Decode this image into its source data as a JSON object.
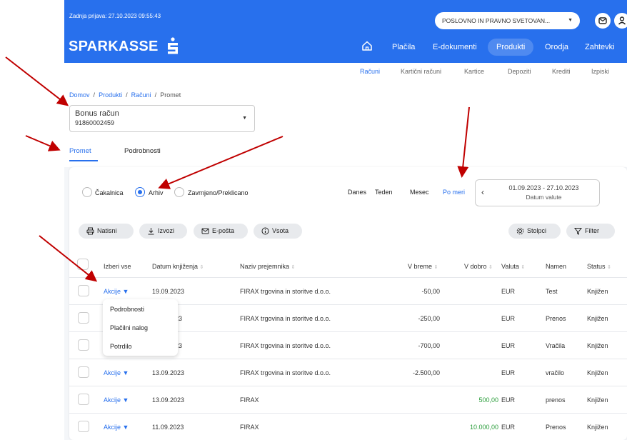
{
  "header": {
    "last_login": "Zadnja prijava: 27.10.2023 09:55:43",
    "account_selector": "POSLOVNO IN PRAVNO SVETOVAN...",
    "logo": "SPARKASSE",
    "nav": [
      "Plačila",
      "E-dokumenti",
      "Produkti",
      "Orodja",
      "Zahtevki"
    ],
    "active_nav": "Produkti",
    "brand_color": "#2870ed"
  },
  "subnav": [
    "Računi",
    "Kartični računi",
    "Kartice",
    "Depoziti",
    "Krediti",
    "Izpiski"
  ],
  "breadcrumb": [
    "Domov",
    "Produkti",
    "Računi",
    "Promet"
  ],
  "account": {
    "name": "Bonus račun",
    "number": "91860002459"
  },
  "tabs": [
    "Promet",
    "Podrobnosti"
  ],
  "filters": {
    "status_options": [
      "Čakalnica",
      "Arhiv",
      "Zavrnjeno/Preklicano"
    ],
    "selected_status": "Arhiv",
    "periods": [
      "Danes",
      "Teden",
      "Mesec",
      "Po meri"
    ],
    "active_period": "Po meri",
    "date_range": "01.09.2023 - 27.10.2023",
    "date_type": "Datum valute"
  },
  "actions": [
    "Natisni",
    "Izvozi",
    "E-pošta",
    "Vsota",
    "Stolpci",
    "Filter"
  ],
  "table": {
    "columns": [
      "Izberi vse",
      "Datum knjiženja",
      "Naziv prejemnika",
      "V breme",
      "V dobro",
      "Valuta",
      "Namen",
      "Status"
    ],
    "action_label": "Akcije",
    "rows": [
      {
        "date": "19.09.2023",
        "payee": "FIRAX trgovina in storitve d.o.o.",
        "debit": "-50,00",
        "credit": "",
        "currency": "EUR",
        "purpose": "Test",
        "status": "Knjižen"
      },
      {
        "date": "23",
        "payee": "FIRAX trgovina in storitve d.o.o.",
        "debit": "-250,00",
        "credit": "",
        "currency": "EUR",
        "purpose": "Prenos",
        "status": "Knjižen"
      },
      {
        "date": "23",
        "payee": "FIRAX trgovina in storitve d.o.o.",
        "debit": "-700,00",
        "credit": "",
        "currency": "EUR",
        "purpose": "Vračila",
        "status": "Knjižen"
      },
      {
        "date": "13.09.2023",
        "payee": "FIRAX trgovina in storitve d.o.o.",
        "debit": "-2.500,00",
        "credit": "",
        "currency": "EUR",
        "purpose": "vračilo",
        "status": "Knjižen"
      },
      {
        "date": "13.09.2023",
        "payee": "FIRAX",
        "debit": "",
        "credit": "500,00",
        "currency": "EUR",
        "purpose": "prenos",
        "status": "Knjižen"
      },
      {
        "date": "11.09.2023",
        "payee": "FIRAX",
        "debit": "",
        "credit": "10.000,00",
        "currency": "EUR",
        "purpose": "Prenos",
        "status": "Knjižen"
      }
    ]
  },
  "akcije_menu": [
    "Podrobnosti",
    "Plačilni nalog",
    "Potrdilo"
  ]
}
